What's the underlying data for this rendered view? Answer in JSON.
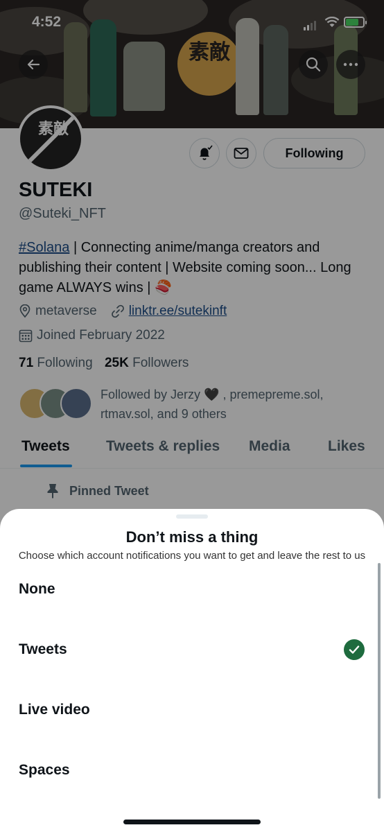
{
  "status_bar": {
    "time": "4:52"
  },
  "banner": {
    "kanji": "素敵"
  },
  "profile": {
    "avatar_kanji": "素敵",
    "follow_label": "Following",
    "name": "SUTEKI",
    "handle": "@Suteki_NFT",
    "bio_tag": "#Solana",
    "bio_rest": " | Connecting anime/manga creators and publishing their content | Website coming soon... Long game ALWAYS wins | 🍣",
    "location": "metaverse",
    "link": "linktr.ee/sutekinft",
    "joined": "Joined February 2022",
    "following_count": "71",
    "following_label": "Following",
    "followers_count": "25K",
    "followers_label": "Followers",
    "followed_by": "Followed by Jerzy 🖤 , premepreme.sol, rtmav.sol, and 9 others"
  },
  "tabs": [
    {
      "label": "Tweets",
      "active": true
    },
    {
      "label": "Tweets & replies",
      "active": false
    },
    {
      "label": "Media",
      "active": false
    },
    {
      "label": "Likes",
      "active": false
    }
  ],
  "pinned_label": "Pinned Tweet",
  "sheet": {
    "title": "Don’t miss a thing",
    "subtitle": "Choose which account notifications you want to get and leave the rest to us",
    "options": [
      {
        "label": "None",
        "selected": false
      },
      {
        "label": "Tweets",
        "selected": true
      },
      {
        "label": "Live video",
        "selected": false
      },
      {
        "label": "Spaces",
        "selected": false
      }
    ]
  },
  "colors": {
    "accent": "#1d9bf0",
    "check": "#1e6b3e",
    "link": "#1d4e89",
    "banner_sun": "#d8a64d"
  },
  "icons": [
    "back-arrow-icon",
    "search-icon",
    "more-icon",
    "bell-icon",
    "mail-icon",
    "location-icon",
    "link-icon",
    "calendar-icon",
    "pin-icon",
    "checkmark-icon"
  ]
}
